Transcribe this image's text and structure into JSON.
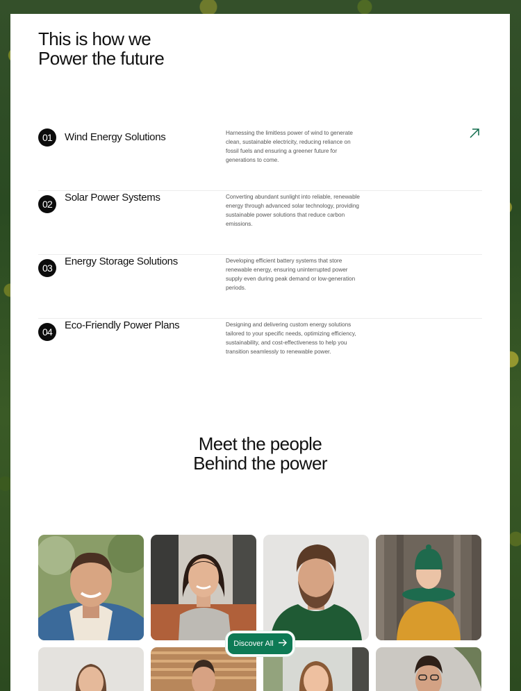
{
  "services_section": {
    "heading_line1": "This is how we",
    "heading_line2": "Power the future",
    "items": [
      {
        "number": "01",
        "title": "Wind Energy Solutions",
        "description": "Harnessing the limitless power of wind to generate clean, sustainable electricity, reducing reliance on fossil fuels and ensuring a greener future for generations to come."
      },
      {
        "number": "02",
        "title": "Solar Power Systems",
        "description": "Converting abundant sunlight into reliable, renewable energy through advanced solar technology, providing sustainable power solutions that reduce carbon emissions."
      },
      {
        "number": "03",
        "title": "Energy Storage Solutions",
        "description": "Developing efficient battery systems that store renewable energy, ensuring uninterrupted power supply even during peak demand or low-generation periods."
      },
      {
        "number": "04",
        "title": "Eco-Friendly Power Plans",
        "description": "Designing and delivering custom energy solutions tailored to your specific needs, optimizing efficiency, sustainability, and cost-effectiveness to help you transition seamlessly to renewable power."
      }
    ],
    "arrow_icon": "arrow-up-right-icon"
  },
  "team_section": {
    "heading_line1": "Meet the people",
    "heading_line2": "Behind the power",
    "discover_label": "Discover All",
    "discover_icon": "arrow-right-icon"
  },
  "colors": {
    "accent": "#0e7a55",
    "badge": "#0c0c0c",
    "background_forest": "#2f4d24"
  }
}
